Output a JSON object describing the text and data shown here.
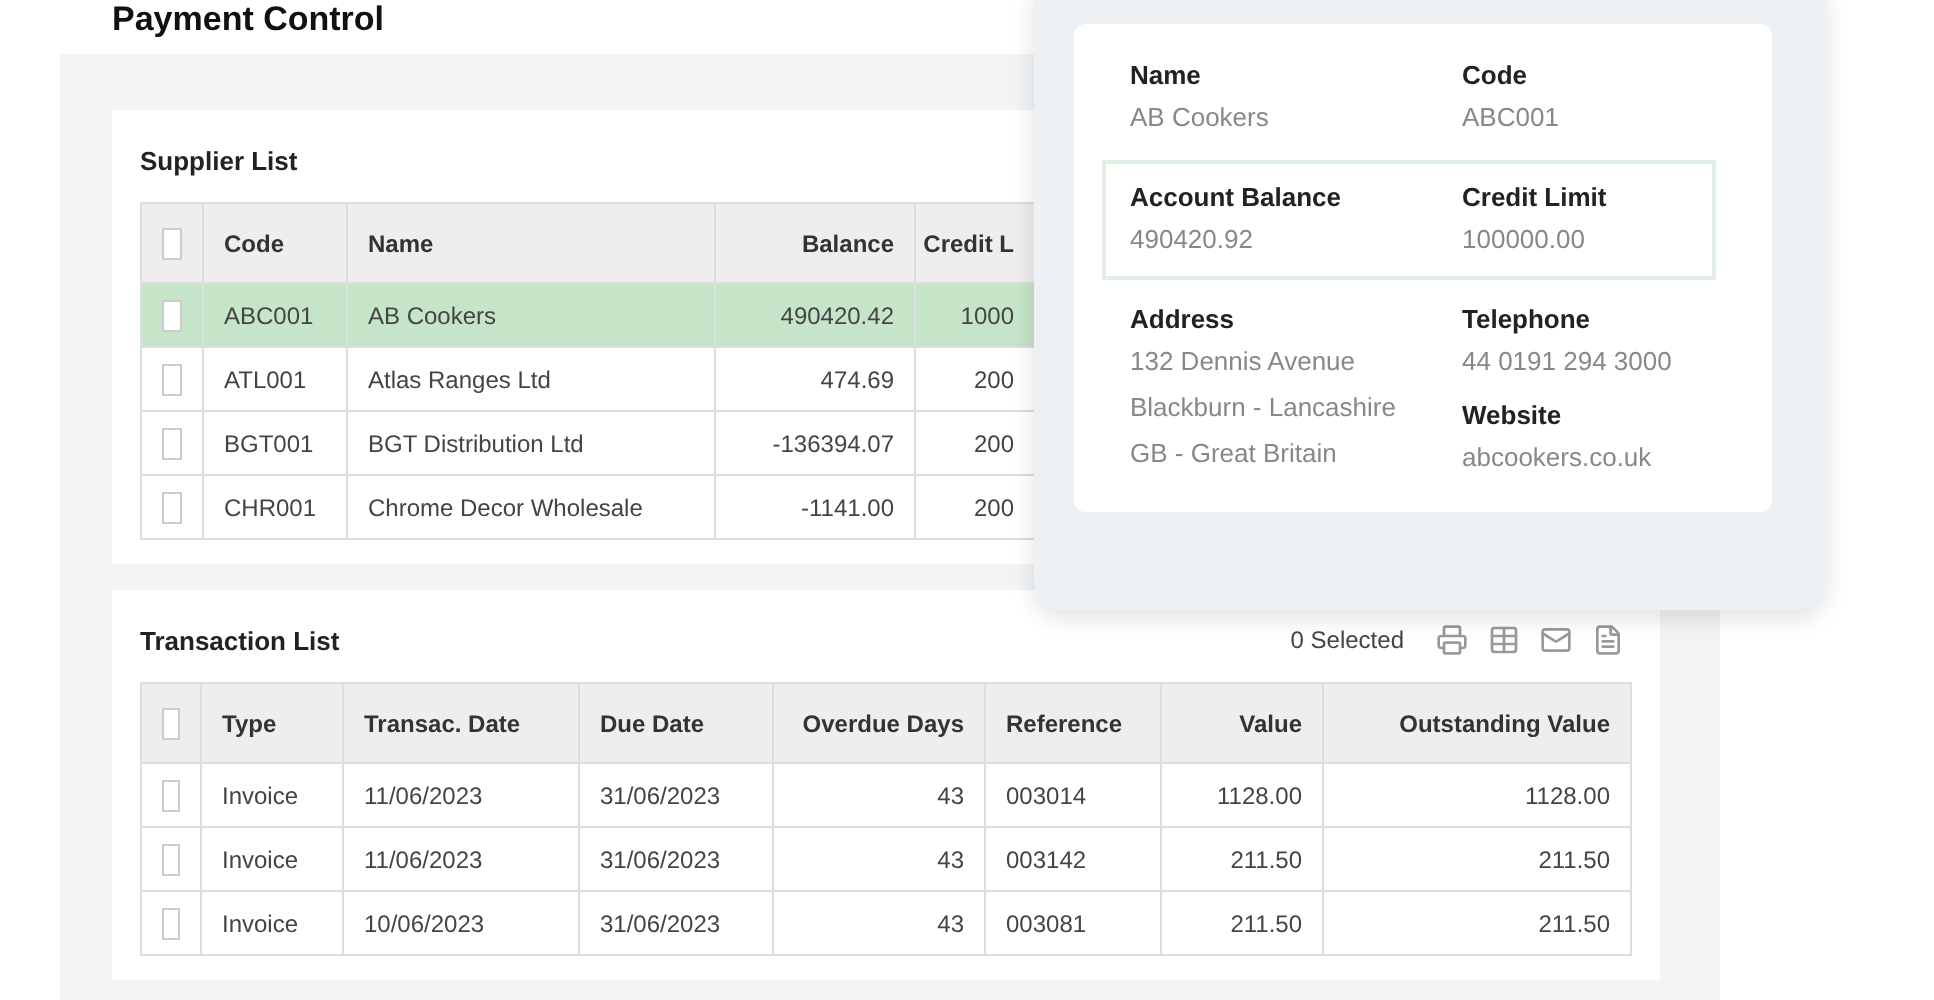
{
  "page": {
    "title": "Payment Control"
  },
  "supplier_list": {
    "title": "Supplier List",
    "header_checked": false,
    "columns": [
      "Code",
      "Name",
      "Balance",
      "Credit L"
    ],
    "rows": [
      {
        "checked": false,
        "selected": true,
        "cells": [
          "ABC001",
          "AB Cookers",
          "490420.42",
          "1000"
        ]
      },
      {
        "checked": false,
        "selected": false,
        "cells": [
          "ATL001",
          "Atlas Ranges Ltd",
          "474.69",
          "200"
        ]
      },
      {
        "checked": false,
        "selected": false,
        "cells": [
          "BGT001",
          "BGT Distribution Ltd",
          "-136394.07",
          "200"
        ]
      },
      {
        "checked": false,
        "selected": false,
        "cells": [
          "CHR001",
          "Chrome Decor Wholesale",
          "-1141.00",
          "200"
        ]
      }
    ]
  },
  "supplier_details": {
    "fields": [
      {
        "label": "Name",
        "lines": [
          "AB Cookers"
        ]
      },
      {
        "label": "Code",
        "lines": [
          "ABC001"
        ]
      },
      {
        "label": "Account Balance",
        "lines": [
          "490420.92"
        ]
      },
      {
        "label": "Credit Limit",
        "lines": [
          "100000.00"
        ]
      },
      {
        "label": "Address",
        "lines": [
          "132 Dennis Avenue",
          "Blackburn - Lancashire",
          "GB - Great Britain"
        ]
      },
      {
        "label": "Telephone",
        "lines": [
          "44 0191 294 3000"
        ]
      },
      {
        "label": "Website",
        "lines": [
          "abcookers.co.uk"
        ]
      }
    ]
  },
  "transaction_list": {
    "title": "Transaction List",
    "selected_count": "0 Selected",
    "header_checked": false,
    "columns": [
      "Type",
      "Transac. Date",
      "Due Date",
      "Overdue Days",
      "Reference",
      "Value",
      "Outstanding Value"
    ],
    "rows": [
      {
        "checked": false,
        "cells": [
          "Invoice",
          "11/06/2023",
          "31/06/2023",
          "43",
          "003014",
          "1128.00",
          "1128.00"
        ]
      },
      {
        "checked": false,
        "cells": [
          "Invoice",
          "11/06/2023",
          "31/06/2023",
          "43",
          "003142",
          "211.50",
          "211.50"
        ]
      },
      {
        "checked": false,
        "cells": [
          "Invoice",
          "10/06/2023",
          "31/06/2023",
          "43",
          "003081",
          "211.50",
          "211.50"
        ]
      }
    ]
  }
}
